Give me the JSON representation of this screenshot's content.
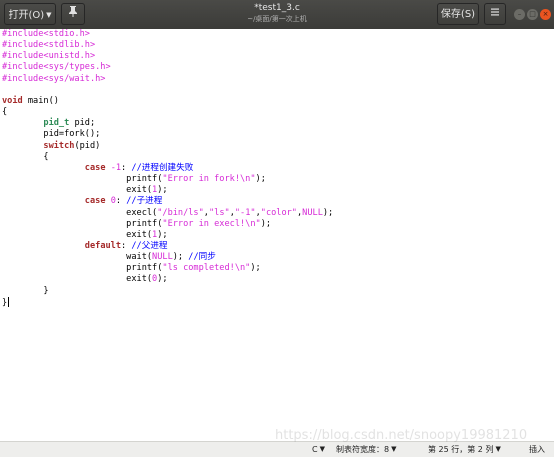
{
  "header": {
    "open_label": "打开(O)",
    "title": "*test1_3.c",
    "subtitle": "~/桌面/第一次上机",
    "save_label": "保存(S)",
    "pin_icon": "pin-icon",
    "menu_icon": "hamburger-menu-icon",
    "window_controls": [
      "minimize",
      "maximize",
      "close"
    ]
  },
  "editor": {
    "lines": [
      "#include<stdio.h>",
      "#include<stdlib.h>",
      "#include<unistd.h>",
      "#include<sys/types.h>",
      "#include<sys/wait.h>",
      "",
      "void main()",
      "{",
      "        pid_t pid;",
      "        pid=fork();",
      "        switch(pid)",
      "        {",
      "                case -1: //进程创建失败",
      "                        printf(\"Error in fork!\\n\");",
      "                        exit(1);",
      "                case 0: //子进程",
      "                        execl(\"/bin/ls\",\"ls\",\"-1\",\"color\",NULL);",
      "                        printf(\"Error in execl!\\n\");",
      "                        exit(1);",
      "                default: //父进程",
      "                        wait(NULL); //同步",
      "                        printf(\"ls completed!\\n\");",
      "                        exit(0);",
      "        }",
      "}"
    ]
  },
  "statusbar": {
    "language": "C",
    "tab_width": "制表符宽度：8",
    "position": "第 25 行，第 2 列",
    "mode": "插入"
  },
  "watermark": "https://blog.csdn.net/snoopy19981210",
  "colors": {
    "titlebar": "#3c3b37",
    "close_button": "#e95420",
    "preprocessor": "#d62ad6",
    "keyword": "#a52a2a",
    "type": "#2e8b57",
    "comment": "#0000ff"
  }
}
